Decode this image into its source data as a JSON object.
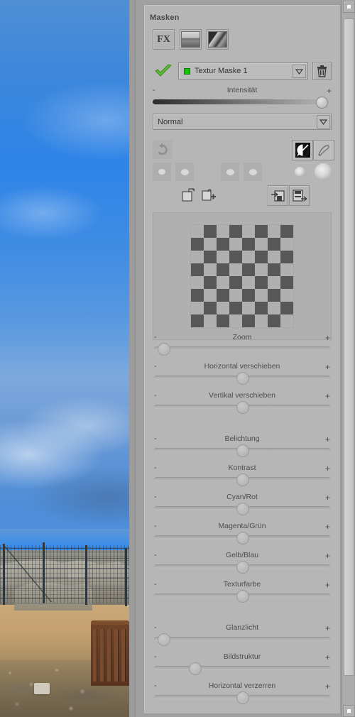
{
  "panel": {
    "title": "Masken",
    "fx_buttons": [
      {
        "name": "fx-button",
        "label": "FX"
      },
      {
        "name": "original-thumbnail-button",
        "label": ""
      },
      {
        "name": "texture-thumbnail-button",
        "label": ""
      }
    ],
    "mask_row": {
      "enabled_icon": "check-icon",
      "mask_name": "Textur Maske 1",
      "dropdown_icon": "chevron-down-icon",
      "delete_icon": "trash-icon",
      "status_color": "#16c40a"
    },
    "intensity": {
      "label": "Intensität",
      "minus": "-",
      "plus": "+",
      "value_pct": 97
    },
    "blend_mode": {
      "selected": "Normal",
      "dropdown_icon": "chevron-down-icon"
    },
    "tools_row1": [
      {
        "name": "undo-button",
        "icon": "undo-arrow-icon"
      },
      {
        "name": "invert-mask-button",
        "icon": "half-circle-icon"
      },
      {
        "name": "brush-tool-button",
        "icon": "brush-icon"
      }
    ],
    "tools_row2": [
      {
        "name": "brush-size-1-button",
        "icon": "dot-small-icon"
      },
      {
        "name": "brush-size-2-button",
        "icon": "dot-small-icon"
      },
      {
        "name": "brush-size-3-button",
        "icon": "dot-small-icon"
      },
      {
        "name": "brush-size-4-button",
        "icon": "dot-small-icon"
      },
      {
        "name": "soft-brush-small-button",
        "icon": "soft-dot-icon"
      },
      {
        "name": "soft-brush-large-button",
        "icon": "soft-dot-large-icon"
      }
    ],
    "tools_row3": [
      {
        "name": "load-mask-button",
        "icon": "open-file-icon"
      },
      {
        "name": "add-mask-button",
        "icon": "add-file-icon"
      },
      {
        "name": "import-mask-button",
        "icon": "import-disk-icon"
      },
      {
        "name": "export-mask-button",
        "icon": "export-disk-icon"
      }
    ],
    "preview": {
      "name": "mask-preview",
      "pattern": "checkerboard",
      "squares": 8,
      "dark_color": "#575757",
      "light_color": "#b0b0b0"
    },
    "sliders": [
      {
        "label": "Zoom",
        "value_pct": 2,
        "minus": "-",
        "plus": "+"
      },
      {
        "label": "Horizontal verschieben",
        "value_pct": 50,
        "minus": "-",
        "plus": "+"
      },
      {
        "label": "Vertikal verschieben",
        "value_pct": 50,
        "minus": "-",
        "plus": "+"
      },
      {
        "label": "Belichtung",
        "value_pct": 50,
        "minus": "-",
        "plus": "+"
      },
      {
        "label": "Kontrast",
        "value_pct": 50,
        "minus": "-",
        "plus": "+"
      },
      {
        "label": "Cyan/Rot",
        "value_pct": 50,
        "minus": "-",
        "plus": "+"
      },
      {
        "label": "Magenta/Grün",
        "value_pct": 50,
        "minus": "-",
        "plus": "+"
      },
      {
        "label": "Gelb/Blau",
        "value_pct": 50,
        "minus": "-",
        "plus": "+"
      },
      {
        "label": "Texturfarbe",
        "value_pct": 50,
        "minus": "-",
        "plus": "+"
      },
      {
        "label": "Glanzlicht",
        "value_pct": 2,
        "minus": "-",
        "plus": "+"
      },
      {
        "label": "Bildstruktur",
        "value_pct": 21,
        "minus": "-",
        "plus": "+"
      },
      {
        "label": "Horizontal verzerren",
        "value_pct": 50,
        "minus": "-",
        "plus": "+"
      }
    ]
  },
  "scrollbar": {
    "up_icon": "scroll-up-icon",
    "down_icon": "scroll-down-icon",
    "thumb_name": "scrollbar-thumb"
  }
}
